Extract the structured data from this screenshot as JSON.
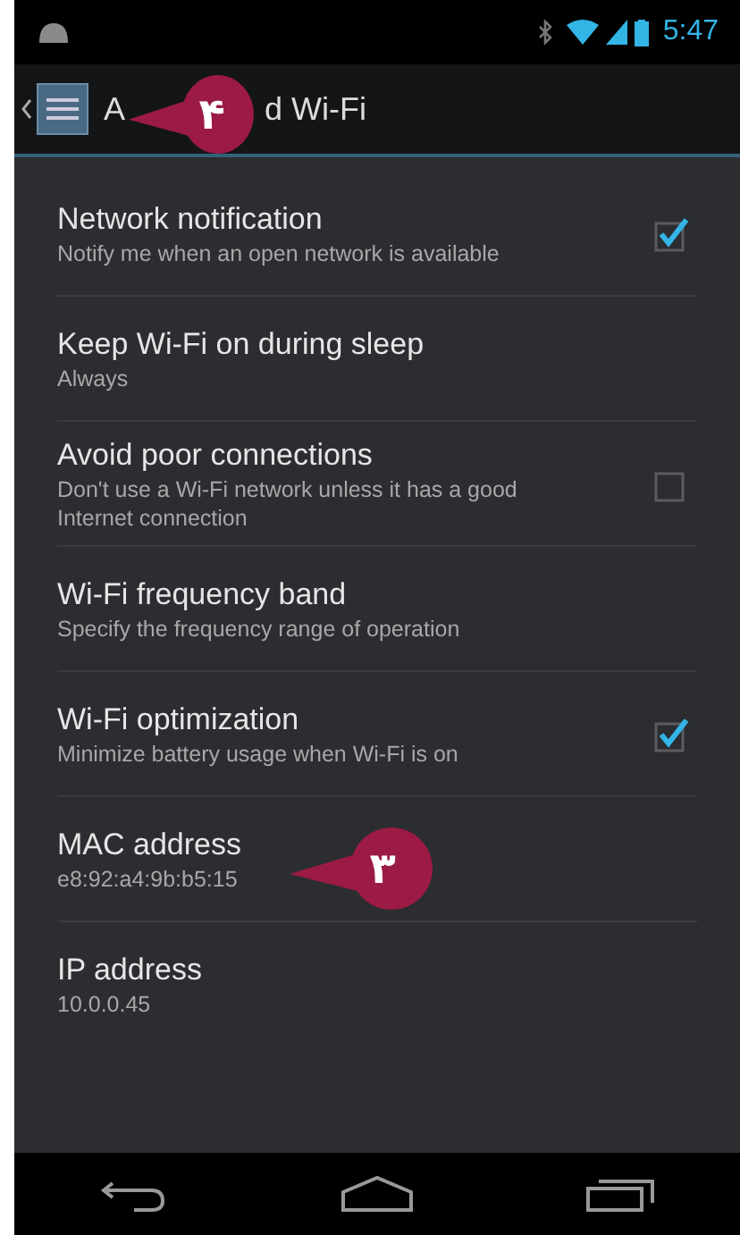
{
  "status_bar": {
    "time": "5:47"
  },
  "action_bar": {
    "title_start": "A",
    "title_end": "d Wi-Fi"
  },
  "settings": [
    {
      "kind": "checkbox",
      "title": "Network notification",
      "summary": "Notify me when an open network is available",
      "checked": true
    },
    {
      "kind": "plain",
      "title": "Keep Wi-Fi on during sleep",
      "summary": "Always"
    },
    {
      "kind": "checkbox",
      "title": "Avoid poor connections",
      "summary": "Don't use a Wi-Fi network unless it has a good Internet connection",
      "checked": false
    },
    {
      "kind": "plain",
      "title": "Wi-Fi frequency band",
      "summary": "Specify the frequency range of operation"
    },
    {
      "kind": "checkbox",
      "title": "Wi-Fi optimization",
      "summary": "Minimize battery usage when Wi-Fi is on",
      "checked": true
    },
    {
      "kind": "plain",
      "title": "MAC address",
      "summary": "e8:92:a4:9b:b5:15"
    },
    {
      "kind": "plain",
      "title": "IP address",
      "summary": "10.0.0.45"
    }
  ],
  "callouts": [
    {
      "label": "۴"
    },
    {
      "label": "۳"
    }
  ]
}
